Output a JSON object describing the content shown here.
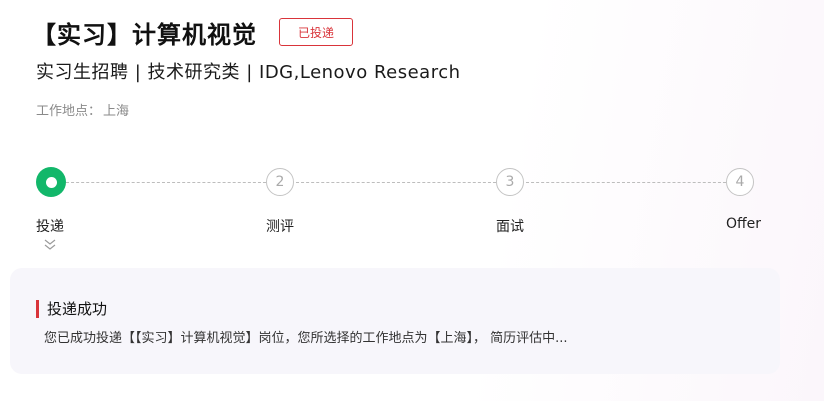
{
  "job": {
    "title": "【实习】计算机视觉",
    "status": "已投递",
    "subtitle": "实习生招聘 | 技术研究类 | IDG,Lenovo Research",
    "location_label": "工作地点：",
    "location_value": "上海"
  },
  "steps": [
    {
      "number": "",
      "label": "投递",
      "state": "active"
    },
    {
      "number": "2",
      "label": "测评",
      "state": "pending"
    },
    {
      "number": "3",
      "label": "面试",
      "state": "pending"
    },
    {
      "number": "4",
      "label": "Offer",
      "state": "pending"
    }
  ],
  "result": {
    "title": "投递成功",
    "message": "您已成功投递【【实习】计算机视觉】岗位，您所选择的工作地点为【上海】， 简历评估中..."
  },
  "colors": {
    "accent_red": "#d9343a",
    "active_green": "#12b76a"
  },
  "icons": {
    "expand": "chevron-double-down-icon"
  }
}
